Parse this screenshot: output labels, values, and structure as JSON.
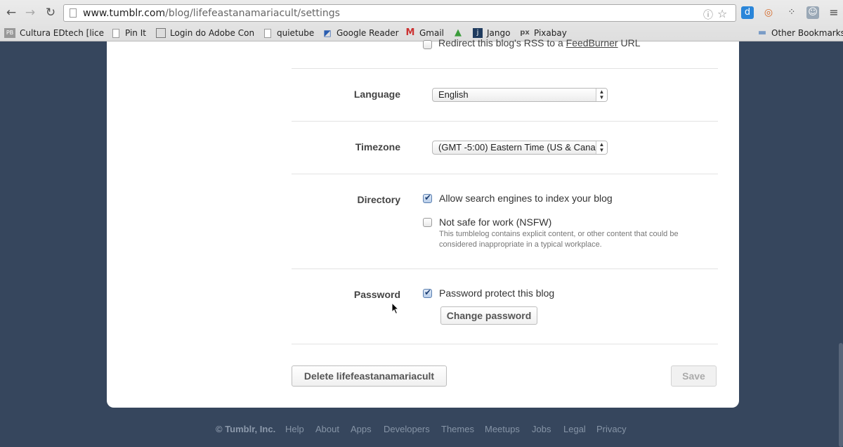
{
  "browser": {
    "url_host": "www.tumblr.com",
    "url_path": "/blog/lifefeastanamariacult/settings",
    "bookmarks": [
      {
        "label": "Cultura EDtech [lice",
        "icon": "PB"
      },
      {
        "label": "Pin It",
        "icon": "doc"
      },
      {
        "label": "Login do Adobe Con",
        "icon": "adobe"
      },
      {
        "label": "quietube",
        "icon": "doc"
      },
      {
        "label": "Google Reader",
        "icon": "reader"
      },
      {
        "label": "Gmail",
        "icon": "M"
      },
      {
        "label": "",
        "icon": "drive"
      },
      {
        "label": "Jango",
        "icon": "j"
      },
      {
        "label": "Pixabay",
        "icon": "px"
      }
    ],
    "other_bookmarks": "Other Bookmarks"
  },
  "settings": {
    "rss": {
      "text_before": "Redirect this blog's RSS to a ",
      "link": "FeedBurner",
      "text_after": " URL",
      "checked": false
    },
    "language": {
      "label": "Language",
      "value": "English"
    },
    "timezone": {
      "label": "Timezone",
      "value": "(GMT -5:00) Eastern Time (US & Cana"
    },
    "directory": {
      "label": "Directory",
      "search_engines": {
        "text": "Allow search engines to index your blog",
        "checked": true
      },
      "nsfw": {
        "text": "Not safe for work (NSFW)",
        "checked": false,
        "description": "This tumblelog contains explicit content, or other content that could be considered inappropriate in a typical workplace."
      }
    },
    "password": {
      "label": "Password",
      "protect": {
        "text": "Password protect this blog",
        "checked": true
      },
      "change_button": "Change password"
    },
    "delete_button": "Delete lifefeastanamariacult",
    "save_button": "Save"
  },
  "footer": {
    "copyright": "© Tumblr, Inc.",
    "links": [
      "Help",
      "About",
      "Apps",
      "Developers",
      "Themes",
      "Meetups",
      "Jobs",
      "Legal",
      "Privacy"
    ]
  },
  "colors": {
    "background": "#36465d",
    "panel": "#ffffff"
  }
}
